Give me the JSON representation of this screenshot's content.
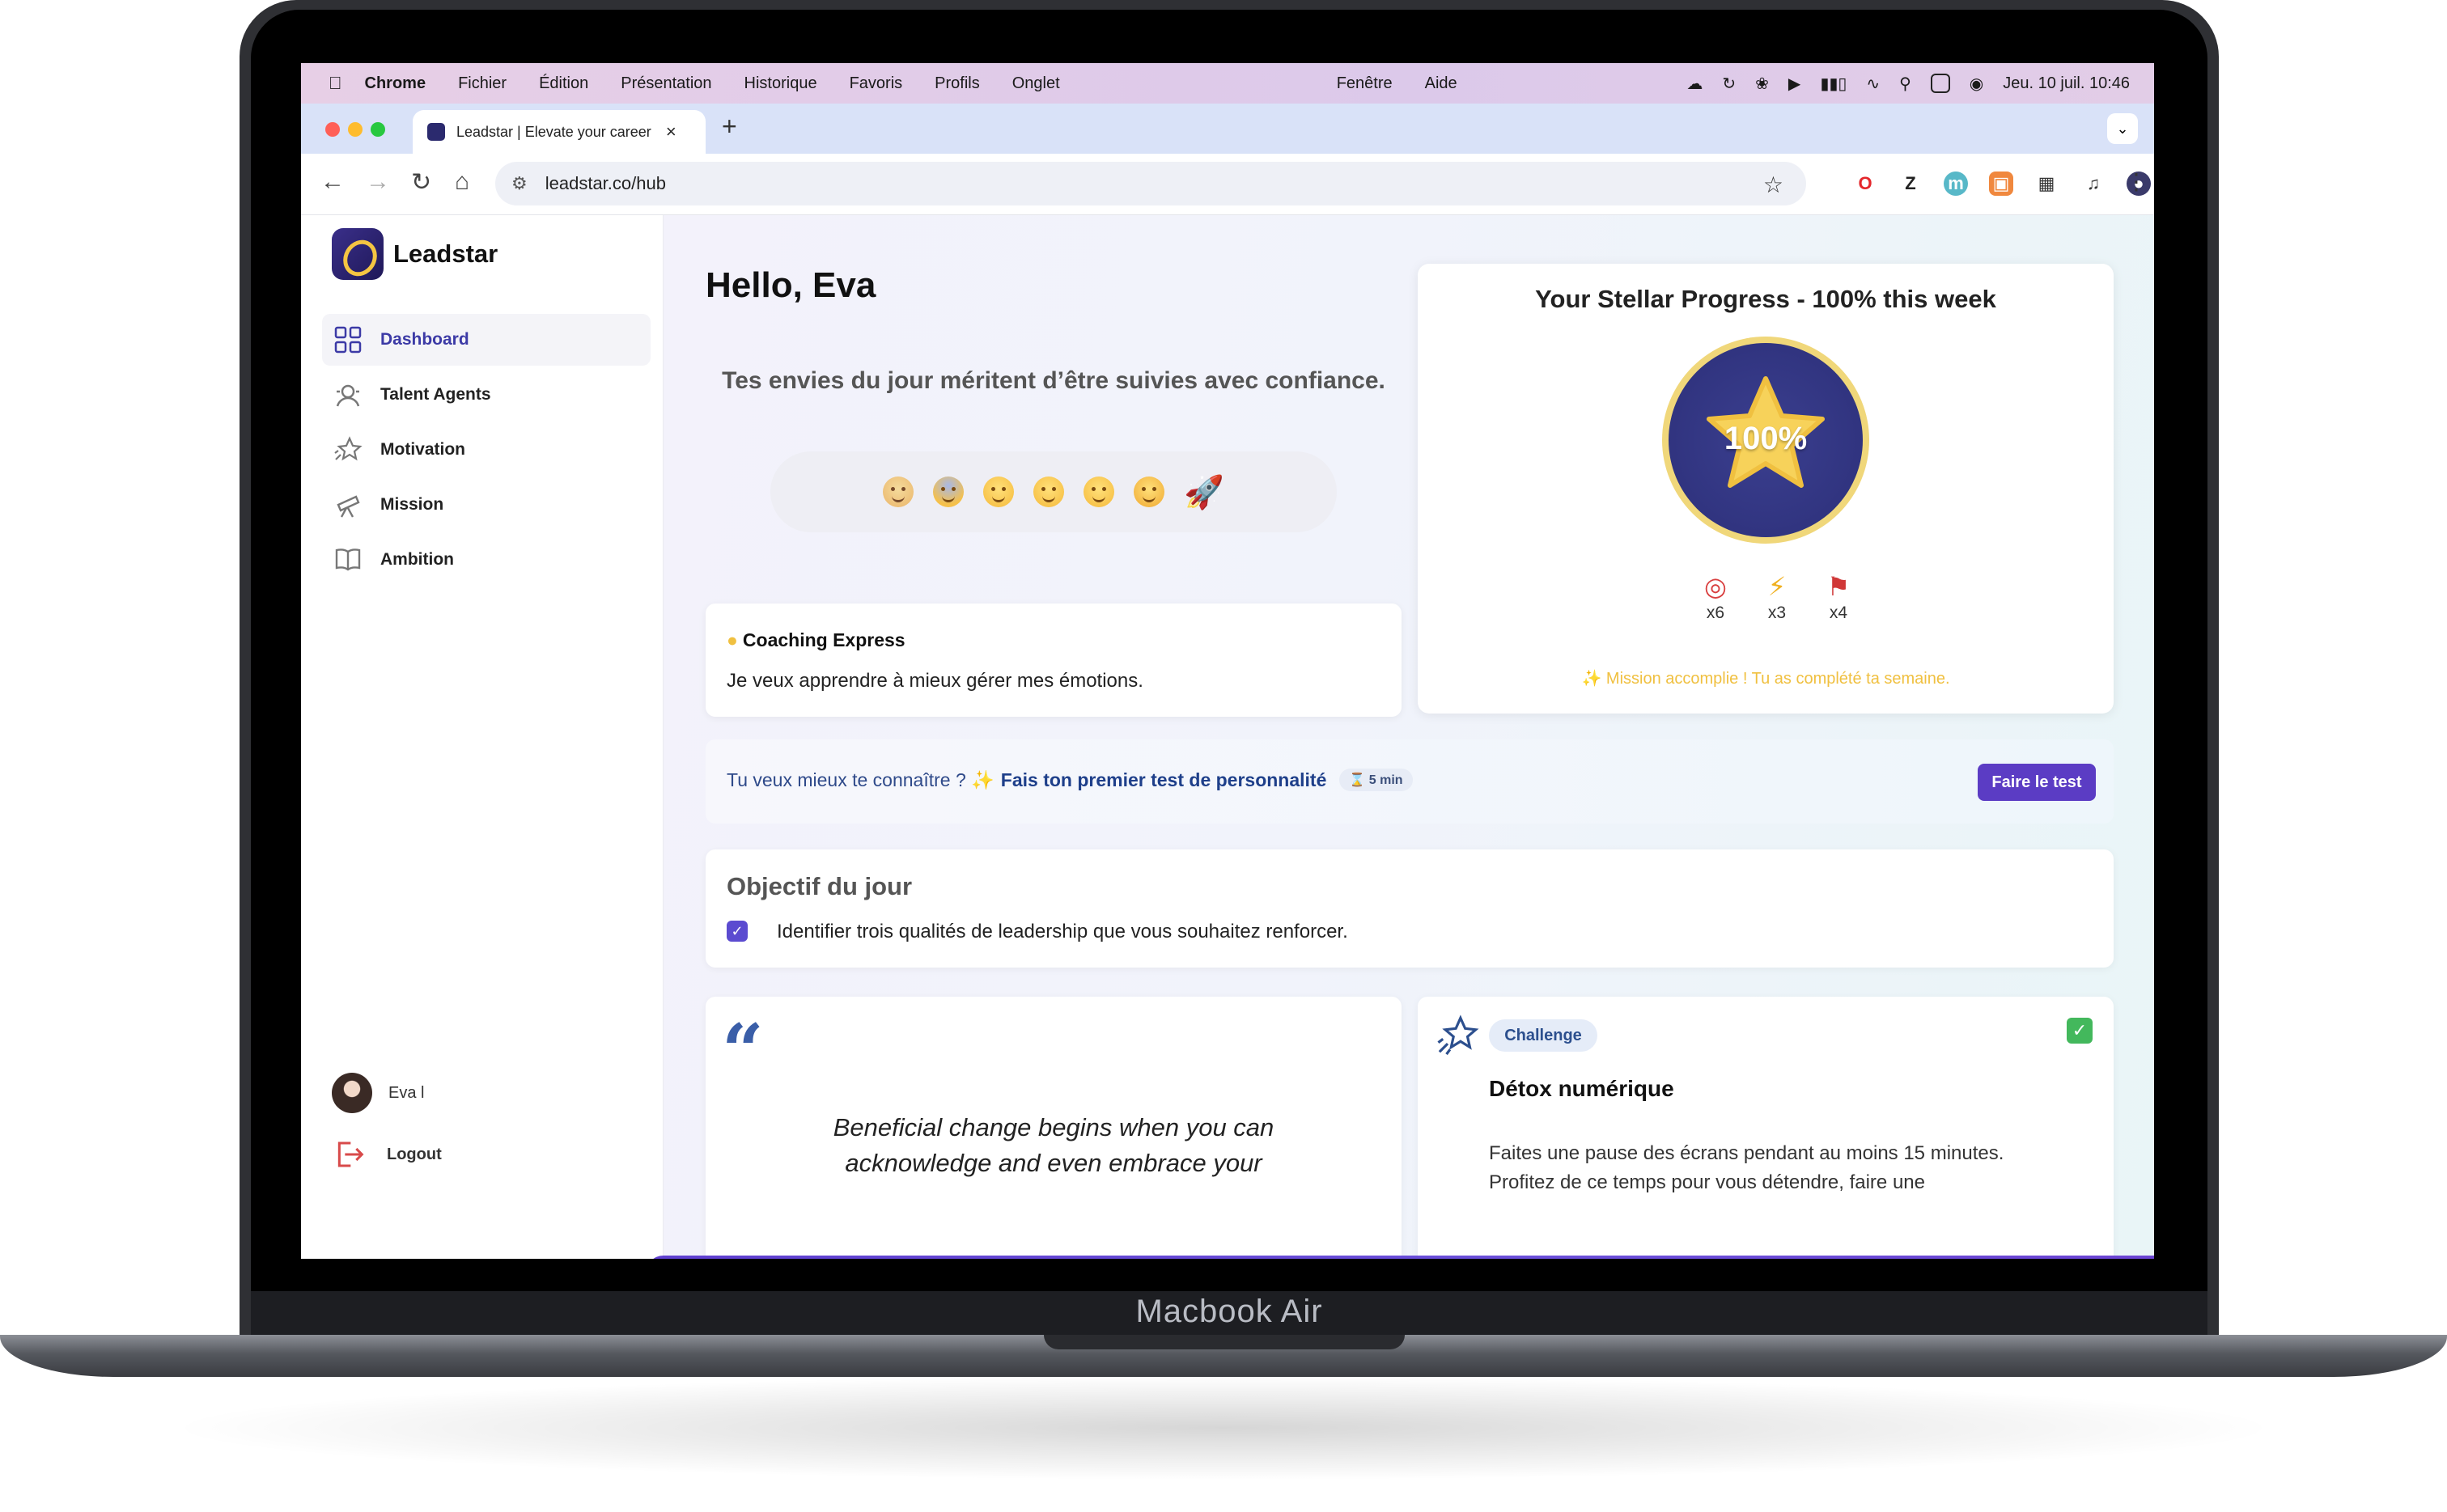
{
  "menubar": {
    "browser": "Chrome",
    "items": [
      "Fichier",
      "Édition",
      "Présentation",
      "Historique",
      "Favoris",
      "Profils",
      "Onglet",
      "Fenêtre",
      "Aide"
    ],
    "datetime": "Jeu. 10 juil.  10:46"
  },
  "tab": {
    "title": "Leadstar | Elevate your career"
  },
  "toolbar": {
    "url": "leadstar.co/hub"
  },
  "sidebar": {
    "brand": "Leadstar",
    "items": [
      {
        "label": "Dashboard",
        "icon": "grid-icon",
        "active": true
      },
      {
        "label": "Talent Agents",
        "icon": "agents-icon",
        "active": false
      },
      {
        "label": "Motivation",
        "icon": "sparkle-star-icon",
        "active": false
      },
      {
        "label": "Mission",
        "icon": "telescope-icon",
        "active": false
      },
      {
        "label": "Ambition",
        "icon": "book-icon",
        "active": false
      }
    ],
    "user_name": "Eva l",
    "logout_label": "Logout"
  },
  "main": {
    "greeting": "Hello, Eva",
    "subtitle": "Tes envies du jour méritent d’être suivies avec confiance.",
    "moods": [
      "sad-face",
      "anxious-face",
      "neutral-face",
      "smile-face",
      "grin-face",
      "star-struck-face",
      "rocket"
    ],
    "coaching": {
      "title": "Coaching Express",
      "text": "Je veux apprendre à mieux gérer mes émotions."
    },
    "progress": {
      "title": "Your Stellar Progress - 100% this week",
      "percent_label": "100%",
      "stats": [
        {
          "icon": "target-icon",
          "count": "x6"
        },
        {
          "icon": "lightning-icon",
          "count": "x3"
        },
        {
          "icon": "flag-icon",
          "count": "x4"
        }
      ],
      "message": "✨ Mission accomplie ! Tu as complété ta semaine."
    },
    "test": {
      "lead": "Tu veux mieux te connaître ? ✨",
      "link": "Fais ton premier test de personnalité",
      "duration": "⌛ 5 min",
      "button": "Faire le test"
    },
    "objective": {
      "title": "Objectif du jour",
      "text": "Identifier trois qualités de leadership que vous souhaitez renforcer."
    },
    "quote": {
      "text": "Beneficial change begins when you can acknowledge and even embrace your"
    },
    "challenge": {
      "badge": "Challenge",
      "title": "Détox numérique",
      "text": "Faites une pause des écrans pendant au moins 15 minutes. Profitez de ce temps pour vous détendre, faire une"
    }
  },
  "laptop": {
    "label": "Macbook Air"
  },
  "colors": {
    "accent": "#5b3cc4",
    "brand_dark": "#2c2f79",
    "gold": "#f5c542",
    "success": "#43b85c"
  }
}
